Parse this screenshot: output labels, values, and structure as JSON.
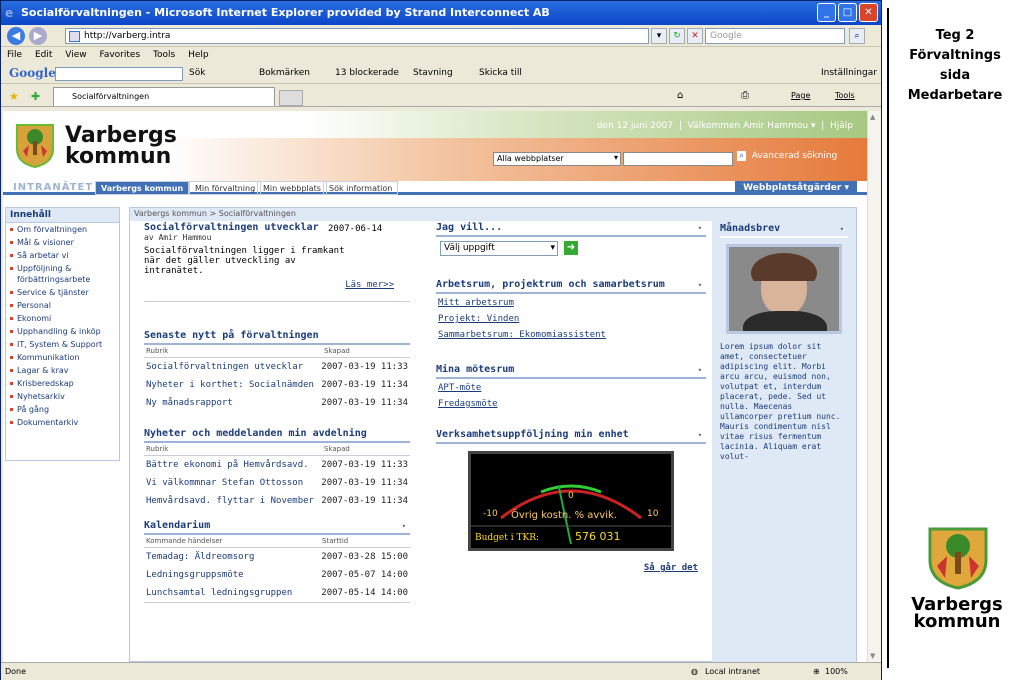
{
  "window": {
    "title": "Socialförvaltningen - Microsoft Internet Explorer provided by Strand Interconnect AB"
  },
  "address": {
    "url": "http://varberg.intra",
    "search_placeholder": "Google"
  },
  "menu": [
    "File",
    "Edit",
    "View",
    "Favorites",
    "Tools",
    "Help"
  ],
  "google_bar": {
    "logo": "Google",
    "items": [
      "Sök",
      "Bokmärken",
      "13 blockerade",
      "Stavning",
      "Skicka till"
    ],
    "settings": "Inställningar"
  },
  "tab": {
    "label": "Socialförvaltningen"
  },
  "ie_tools": {
    "page": "Page",
    "tools": "Tools"
  },
  "header": {
    "logo_line1": "Varbergs",
    "logo_line2": "kommun",
    "date": "den 12 juni 2007",
    "welcome": "Välkommen Amir Hammou",
    "help": "Hjälp",
    "scope": "Alla webbplatser",
    "adv_search": "Avancerad sökning"
  },
  "nav": {
    "intranet": "INTRANÄTET",
    "tabs": [
      "Varbergs kommun",
      "Min förvaltning",
      "Min webbplats",
      "Sök information"
    ],
    "site_actions": "Webbplatsåtgärder"
  },
  "left_nav": {
    "heading": "Innehåll",
    "items": [
      "Om förvaltningen",
      "Mål & visioner",
      "Så arbetar vi",
      "Uppföljning & förbättringsarbete",
      "Service & tjänster",
      "Personal",
      "Ekonomi",
      "Upphandling & inköp",
      "IT, System & Support",
      "Kommunikation",
      "Lagar & krav",
      "Krisberedskap",
      "Nyhetsarkiv",
      "På gång",
      "Dokumentarkiv"
    ]
  },
  "breadcrumb": "Varbergs kommun > Socialförvaltningen",
  "featured": {
    "title": "Socialförvaltningen utvecklar",
    "date": "2007-06-14",
    "author": "av Amir Hammou",
    "body": "Socialförvaltningen ligger i framkant när det gäller utveckling av intranätet.",
    "more": "Läs mer>>"
  },
  "news1": {
    "title": "Senaste nytt på förvaltningen",
    "col1": "Rubrik",
    "col2": "Skapad",
    "rows": [
      {
        "title": "Socialförvaltningen utvecklar",
        "date": "2007-03-19 11:33"
      },
      {
        "title": "Nyheter i korthet: Socialnämden",
        "date": "2007-03-19 11:34"
      },
      {
        "title": "Ny månadsrapport",
        "date": "2007-03-19 11:34"
      }
    ]
  },
  "news2": {
    "title": "Nyheter och meddelanden min avdelning",
    "col1": "Rubrik",
    "col2": "Skapad",
    "rows": [
      {
        "title": "Bättre ekonomi på Hemvårdsavd.",
        "date": "2007-03-19 11:33"
      },
      {
        "title": "Vi välkommnar Stefan Ottosson",
        "date": "2007-03-19 11:34"
      },
      {
        "title": "Hemvårdsavd. flyttar i November",
        "date": "2007-03-19 11:34"
      }
    ]
  },
  "calendar": {
    "title": "Kalendarium",
    "col1": "Kommande händelser",
    "col2": "Starttid",
    "rows": [
      {
        "title": "Temadag: Äldreomsorg",
        "date": "2007-03-28 15:00"
      },
      {
        "title": "Ledningsgruppsmöte",
        "date": "2007-05-07 14:00"
      },
      {
        "title": "Lunchsamtal ledningsgruppen",
        "date": "2007-05-14 14:00"
      }
    ]
  },
  "jag_vill": {
    "title": "Jag vill...",
    "select": "Välj uppgift"
  },
  "workrooms": {
    "title": "Arbetsrum, projektrum och samarbetsrum",
    "links": [
      "Mitt arbetsrum",
      "Projekt: Vinden",
      "Sammarbetsrum: Ekomomiassistent"
    ]
  },
  "meetings": {
    "title": "Mina mötesrum",
    "links": [
      "APT-möte",
      "Fredagsmöte"
    ]
  },
  "followup": {
    "title": "Verksamhetsuppföljning min enhet",
    "gauge_label": "Övrig kostn. % avvik.",
    "min": "-10",
    "mid": "0",
    "max": "10",
    "budget_label": "Budget i TKR:",
    "budget_value": "576 031",
    "value": -2,
    "link": "Så går det"
  },
  "monthly": {
    "title": "Månadsbrev",
    "body": "Lorem ipsum dolor sit amet, consectetuer adipiscing elit. Morbi arcu arcu, euismod non, volutpat et, interdum placerat, pede. Sed ut nulla. Maecenas ullamcorper pretium nunc. Mauris condimentum nisl vitae risus fermentum lacinia. Aliquam erat volut-"
  },
  "status": {
    "left": "Done",
    "zone": "Local intranet",
    "zoom": "100%"
  },
  "side": {
    "title_lines": [
      "Teg 2",
      "Förvaltnings",
      "sida",
      "Medarbetare"
    ],
    "logo_line1": "Varbergs",
    "logo_line2": "kommun"
  }
}
